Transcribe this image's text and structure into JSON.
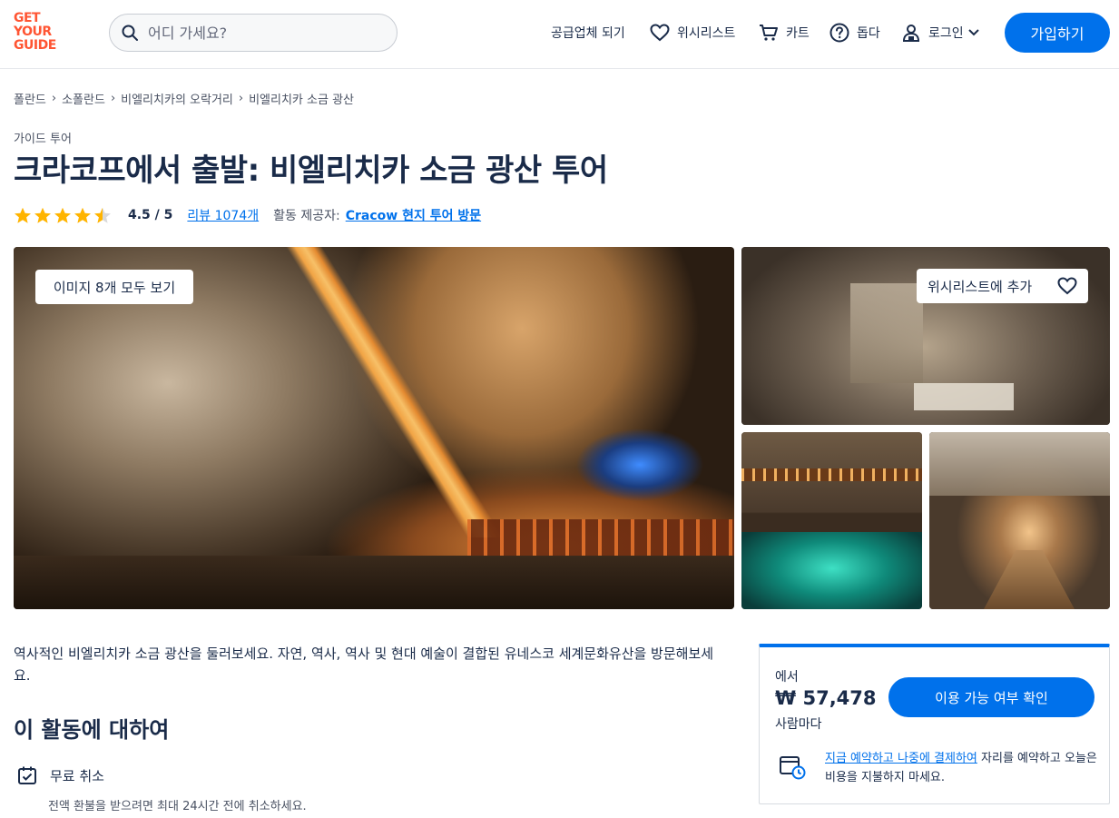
{
  "header": {
    "logo": [
      "GET",
      "YOUR",
      "GUIDE"
    ],
    "search_placeholder": "어디 가세요?",
    "nav": {
      "supplier": "공급업체 되기",
      "wishlist": "위시리스트",
      "cart": "카트",
      "help": "돕다",
      "login": "로그인"
    },
    "signup": "가입하기"
  },
  "breadcrumb": [
    "폴란드",
    "소폴란드",
    "비엘리치카의 오락거리",
    "비엘리치카 소금 광산"
  ],
  "category": "가이드 투어",
  "title": "크라코프에서 출발: 비엘리치카 소금 광산 투어",
  "rating": {
    "value": "4.5 / 5",
    "stars": 4.5,
    "reviews": "리뷰 1074개",
    "provider_label": "활동 제공자:",
    "provider": "Cracow 현지 투어 방문"
  },
  "gallery": {
    "view_all": "이미지 8개 모두 보기",
    "add_wishlist": "위시리스트에 추가"
  },
  "intro": "역사적인 비엘리치카 소금 광산을 둘러보세요. 자연, 역사, 역사 및 현대 예술이 결합된 유네스코 세계문화유산을 방문해보세요.",
  "about": {
    "title": "이 활동에 대하여",
    "features": [
      {
        "label": "무료 취소",
        "desc": "전액 환불을 받으려면 최대 24시간 전에 취소하세요."
      }
    ]
  },
  "booking": {
    "from": "에서",
    "price": "₩ 57,478",
    "per": "사람마다",
    "check": "이용 가능 여부 확인",
    "reserve_link": "지금 예약하고 나중에 결제하여",
    "reserve_text": " 자리를 예약하고 오늘은 비용을 지불하지 마세요."
  },
  "colors": {
    "brand": "#ff5533",
    "accent": "#0071eb",
    "text": "#1a2b49",
    "star": "#ffb400"
  }
}
